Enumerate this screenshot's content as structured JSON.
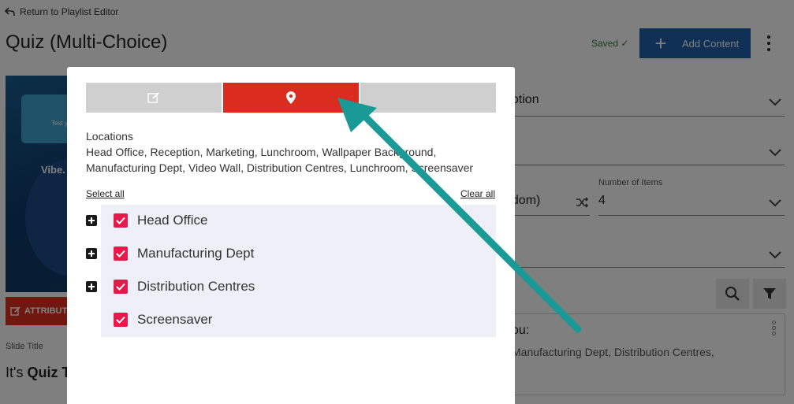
{
  "header": {
    "back_label": "Return to Playlist Editor",
    "title": "Quiz (Multi-Choice)",
    "saved": "Saved ✓",
    "add_content": "Add Content"
  },
  "background": {
    "thumb_text": "Test y",
    "thumb_vibe": "Vibe.",
    "attrib_label": "ATTRIBUT",
    "slide_title_label": "Slide Title",
    "slide_title_value_prefix": "It's ",
    "slide_title_value_bold": "Quiz T",
    "field1": "eption",
    "field3": "ndom)",
    "number_of_items_label": "Number of Items",
    "number_of_items_value": "4",
    "card_title": "ou:",
    "card_body": "Manufacturing Dept, Distribution Centres,"
  },
  "modal": {
    "tabs": [
      {
        "icon": "edit-icon",
        "active": false
      },
      {
        "icon": "location-pin-icon",
        "active": true
      },
      {
        "icon": "",
        "active": false
      }
    ],
    "locations_label": "Locations",
    "locations_summary": "Head Office, Reception, Marketing, Lunchroom, Wallpaper Background, Manufacturing Dept, Video Wall, Distribution Centres, Lunchroom, Screensaver",
    "select_all": "Select all",
    "clear_all": "Clear all",
    "tree": [
      {
        "label": "Head Office",
        "checked": true,
        "expandable": true
      },
      {
        "label": "Manufacturing Dept",
        "checked": true,
        "expandable": true
      },
      {
        "label": "Distribution Centres",
        "checked": true,
        "expandable": true
      },
      {
        "label": "Screensaver",
        "checked": true,
        "expandable": false
      }
    ]
  },
  "colors": {
    "accent_red": "#da2c1f",
    "checkbox_pink": "#e6194b",
    "primary_blue": "#1f5fa8",
    "annotation_teal": "#1a9a96"
  }
}
